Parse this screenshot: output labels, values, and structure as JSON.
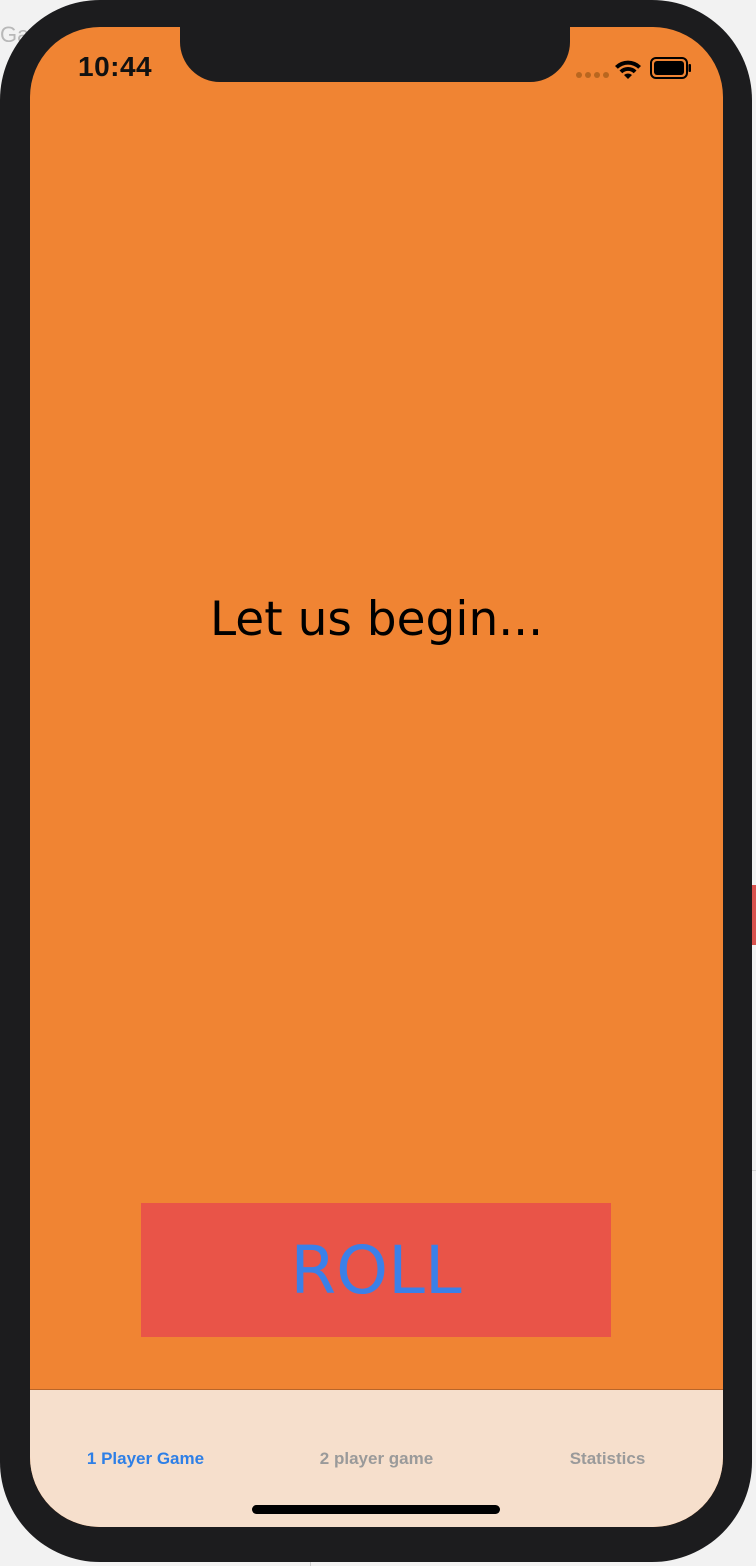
{
  "backdrop": {
    "clipped_text": "Ga"
  },
  "status_bar": {
    "time": "10:44"
  },
  "main": {
    "message": "Let us begin...",
    "roll_button_label": "ROLL"
  },
  "tab_bar": {
    "tabs": [
      {
        "label": "1 Player Game",
        "active": true
      },
      {
        "label": "2 player game",
        "active": false
      },
      {
        "label": "Statistics",
        "active": false
      }
    ]
  },
  "colors": {
    "background": "#f08433",
    "roll_button_bg": "#e95448",
    "roll_button_text": "#3b80e8",
    "tab_bar_bg": "#f6dfcc",
    "tab_active": "#2e7fe6",
    "tab_inactive": "#9a9a9a"
  },
  "icons": {
    "signal": "cellular-signal-icon",
    "wifi": "wifi-icon",
    "battery": "battery-icon"
  }
}
